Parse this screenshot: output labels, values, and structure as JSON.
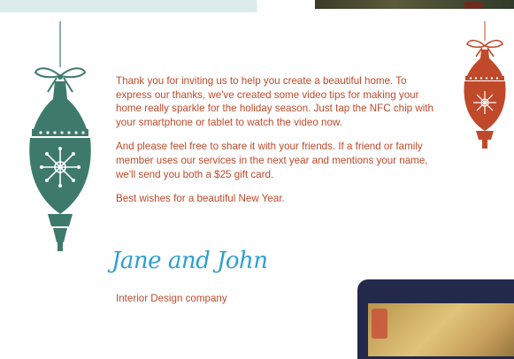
{
  "colors": {
    "text": "#c0492a",
    "signature": "#2d9fd3",
    "ornament_left": "#3e7a6c",
    "ornament_right": "#c0492a"
  },
  "icons": {
    "left_ornament": "christmas-ornament-icon",
    "right_ornament": "christmas-ornament-icon"
  },
  "letter": {
    "paragraph_1": "Thank you for inviting us to help you create a beautiful home. To express our thanks, we've created some video tips for making your home really sparkle for the holiday season. Just tap the NFC chip with your smartphone or tablet to watch the video now.",
    "paragraph_2": "And please feel free to share it with your friends. If a friend or family member uses our services in the next year and mentions your name, we'll send you both a $25 gift card.",
    "closing": "Best wishes for a beautiful New Year.",
    "signature": "Jane and John",
    "company": "Interior Design company"
  }
}
